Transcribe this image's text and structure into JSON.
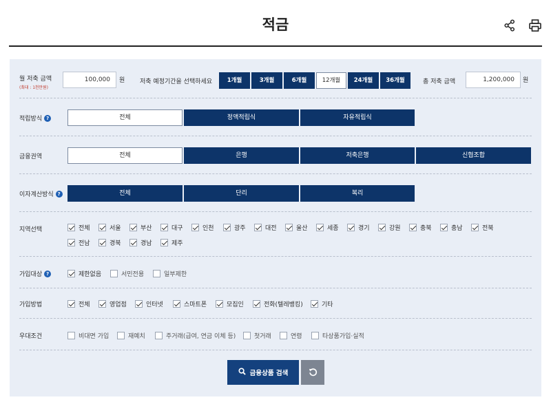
{
  "page": {
    "title": "적금"
  },
  "amount": {
    "monthly_label": "월 저축 금액",
    "monthly_note": "(최대 : 1천만원)",
    "monthly_value": "100,000",
    "unit": "원",
    "period_prompt": "저축 예정기간을 선택하세요",
    "periods": [
      "1개월",
      "3개월",
      "6개월",
      "12개월",
      "24개월",
      "36개월"
    ],
    "selected_period": "12개월",
    "total_label": "총 저축 금액",
    "total_value": "1,200,000"
  },
  "method": {
    "label": "적립방식",
    "options": [
      "전체",
      "정액적립식",
      "자유적립식"
    ],
    "selected": "전체"
  },
  "sector": {
    "label": "금융권역",
    "options": [
      "전체",
      "은행",
      "저축은행",
      "신협조합"
    ],
    "selected": "전체"
  },
  "interest": {
    "label": "이자계산방식",
    "options": [
      "전체",
      "단리",
      "복리"
    ],
    "selected": "none"
  },
  "region": {
    "label": "지역선택",
    "items": [
      "전체",
      "서울",
      "부산",
      "대구",
      "인천",
      "광주",
      "대전",
      "울산",
      "세종",
      "경기",
      "강원",
      "충북",
      "충남",
      "전북",
      "전남",
      "경북",
      "경남",
      "제주"
    ],
    "checked": "all"
  },
  "target": {
    "label": "가입대상",
    "items": [
      {
        "label": "제한없음",
        "checked": true
      },
      {
        "label": "서민전용",
        "checked": false
      },
      {
        "label": "일부제한",
        "checked": false
      }
    ]
  },
  "join_method": {
    "label": "가입방법",
    "items": [
      "전체",
      "영업점",
      "인터넷",
      "스마트폰",
      "모집인",
      "전화(텔레뱅킹)",
      "기타"
    ],
    "checked": "all"
  },
  "preferential": {
    "label": "우대조건",
    "items": [
      "비대면 가입",
      "재예치",
      "주거래(급여, 연금 이체 등)",
      "첫거래",
      "연령",
      "타상품가입·실적"
    ],
    "checked": "none"
  },
  "actions": {
    "search_label": "금융상품 검색"
  },
  "icons": {
    "share": "share-icon",
    "print": "print-icon",
    "search": "search-icon",
    "reset": "reset-icon"
  },
  "colors": {
    "primary": "#0d3469",
    "panel": "#e9eef6",
    "note": "#c0392b",
    "reset": "#7d8592"
  }
}
